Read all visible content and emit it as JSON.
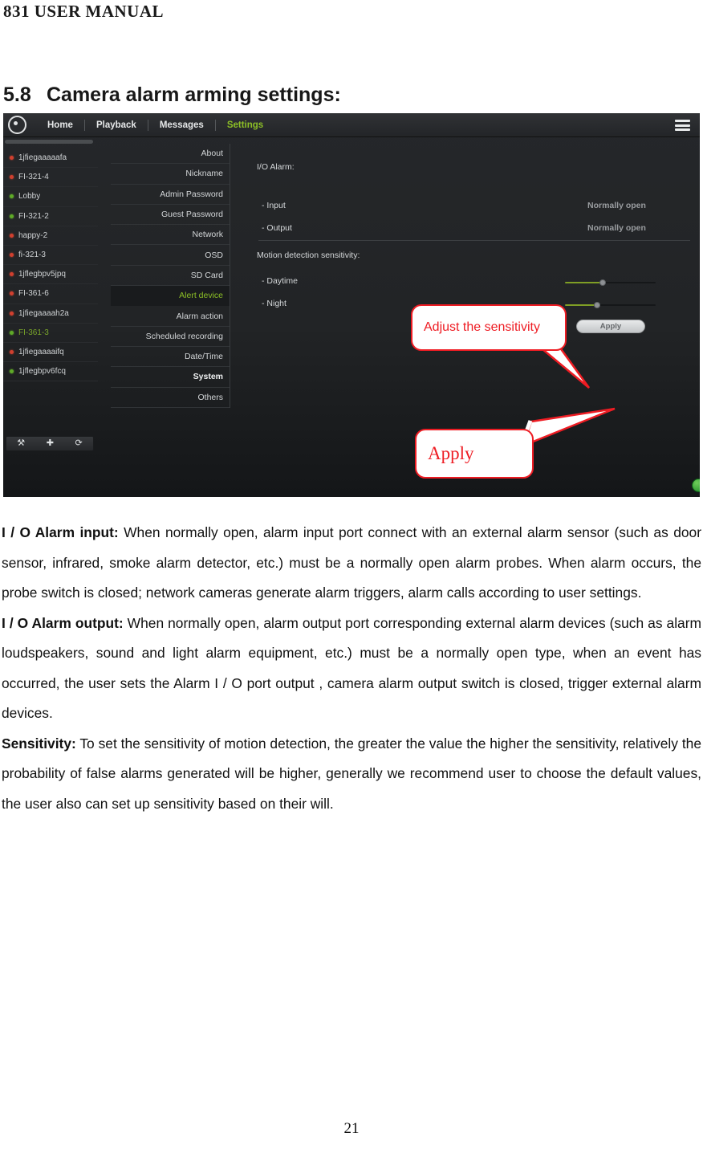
{
  "document": {
    "running_head": "831 USER MANUAL",
    "page_number": "21",
    "section": {
      "number": "5.8",
      "title": "Camera alarm arming settings:"
    }
  },
  "screenshot": {
    "topnav": {
      "logo_icon": "camera-logo-icon",
      "items": [
        {
          "label": "Home",
          "active": false
        },
        {
          "label": "Playback",
          "active": false
        },
        {
          "label": "Messages",
          "active": false
        },
        {
          "label": "Settings",
          "active": true
        }
      ],
      "menu_icon": "hamburger-icon"
    },
    "device_panel": {
      "devices": [
        {
          "name": "1jfiegaaaaafa",
          "status": "offline"
        },
        {
          "name": "FI-321-4",
          "status": "offline"
        },
        {
          "name": "Lobby",
          "status": "online"
        },
        {
          "name": "FI-321-2",
          "status": "online"
        },
        {
          "name": "happy-2",
          "status": "offline"
        },
        {
          "name": "fi-321-3",
          "status": "offline"
        },
        {
          "name": "1jflegbpv5jpq",
          "status": "offline"
        },
        {
          "name": "FI-361-6",
          "status": "offline"
        },
        {
          "name": "1jfiegaaaah2a",
          "status": "offline"
        },
        {
          "name": "FI-361-3",
          "status": "online",
          "selected": true
        },
        {
          "name": "1jfiegaaaaifq",
          "status": "offline"
        },
        {
          "name": "1jflegbpv6fcq",
          "status": "online"
        }
      ],
      "tools": [
        {
          "icon": "wrench-icon",
          "glyph": "⚒"
        },
        {
          "icon": "plus-icon",
          "glyph": "✚"
        },
        {
          "icon": "refresh-icon",
          "glyph": "⟳"
        }
      ]
    },
    "settings_menu": [
      {
        "label": "About",
        "active": false,
        "bold": false
      },
      {
        "label": "Nickname",
        "active": false,
        "bold": false
      },
      {
        "label": "Admin Password",
        "active": false,
        "bold": false
      },
      {
        "label": "Guest Password",
        "active": false,
        "bold": false
      },
      {
        "label": "Network",
        "active": false,
        "bold": false
      },
      {
        "label": "OSD",
        "active": false,
        "bold": false
      },
      {
        "label": "SD Card",
        "active": false,
        "bold": false
      },
      {
        "label": "Alert device",
        "active": true,
        "bold": false
      },
      {
        "label": "Alarm action",
        "active": false,
        "bold": false
      },
      {
        "label": "Scheduled recording",
        "active": false,
        "bold": false
      },
      {
        "label": "Date/Time",
        "active": false,
        "bold": false
      },
      {
        "label": "System",
        "active": false,
        "bold": true
      },
      {
        "label": "Others",
        "active": false,
        "bold": false
      }
    ],
    "form": {
      "io_alarm_heading": "I/O Alarm:",
      "input_label": "- Input",
      "input_value": "Normally open",
      "output_label": "- Output",
      "output_value": "Normally open",
      "motion_heading": "Motion detection sensitivity:",
      "daytime_label": "- Daytime",
      "daytime_percent": 42,
      "night_label": "- Night",
      "night_percent": 35,
      "apply_label": "Apply"
    },
    "callouts": [
      {
        "text": "Adjust the sensitivity",
        "target": "daytime-slider"
      },
      {
        "text": "Apply",
        "target": "apply-button"
      }
    ],
    "colors": {
      "accent_green": "#8cbf26",
      "callout_red": "#ee1c23",
      "status_online": "#5faa28",
      "status_offline": "#d0402f",
      "panel_dark": "#222426"
    }
  },
  "body": {
    "paragraphs": [
      {
        "lead": "I / O Alarm input:",
        "text": " When normally open, alarm input port connect with an external alarm sensor (such as door sensor, infrared, smoke alarm detector, etc.) must be a normally open alarm probes. When alarm occurs, the probe switch is closed; network cameras generate alarm triggers, alarm calls according to user settings."
      },
      {
        "lead": "I / O Alarm output:",
        "text": " When normally open, alarm output port corresponding external alarm devices (such as alarm loudspeakers, sound and light alarm equipment, etc.) must be a normally open type, when an event has occurred, the user sets the Alarm I / O port output , camera alarm output switch is closed, trigger external alarm devices."
      },
      {
        "lead": "Sensitivity:",
        "text": " To set the sensitivity of motion detection, the greater the value the higher the sensitivity, relatively the probability of false alarms generated will be higher, generally we recommend user to choose the default values, the user also can set up sensitivity based on their will."
      }
    ]
  }
}
